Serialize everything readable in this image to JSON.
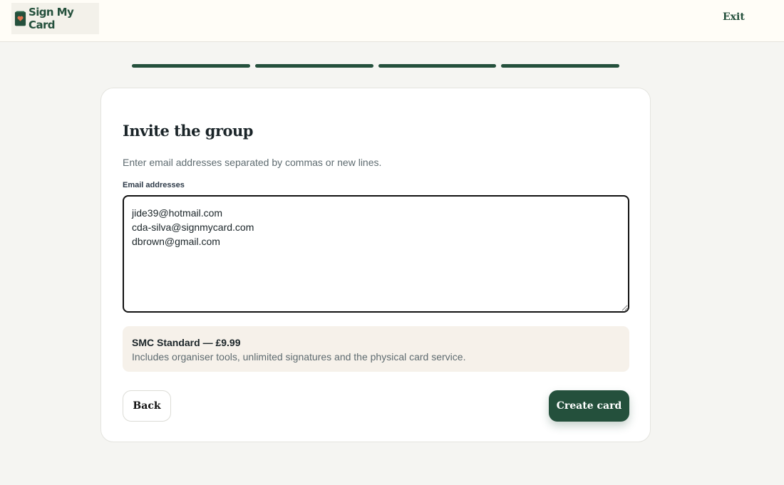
{
  "header": {
    "logo_text": "Sign My Card",
    "exit_label": "Exit"
  },
  "progress": {
    "steps_total": 4,
    "steps_completed": 4,
    "color": "#24503c"
  },
  "form": {
    "title": "Invite the group",
    "subtitle": "Enter email addresses separated by commas or new lines.",
    "email_label": "Email addresses",
    "email_value": "jide39@hotmail.com\ncda-silva@signmycard.com\ndbrown@gmail.com"
  },
  "plan": {
    "name": "SMC Standard — £9.99",
    "description": "Includes organiser tools, unlimited signatures and the physical card service."
  },
  "actions": {
    "back_label": "Back",
    "create_label": "Create card"
  },
  "icons": {
    "logo": "card-heart-icon"
  },
  "colors": {
    "brand": "#24503c",
    "logo_heart": "#e2734f",
    "plan_background": "#f6f1ea"
  }
}
